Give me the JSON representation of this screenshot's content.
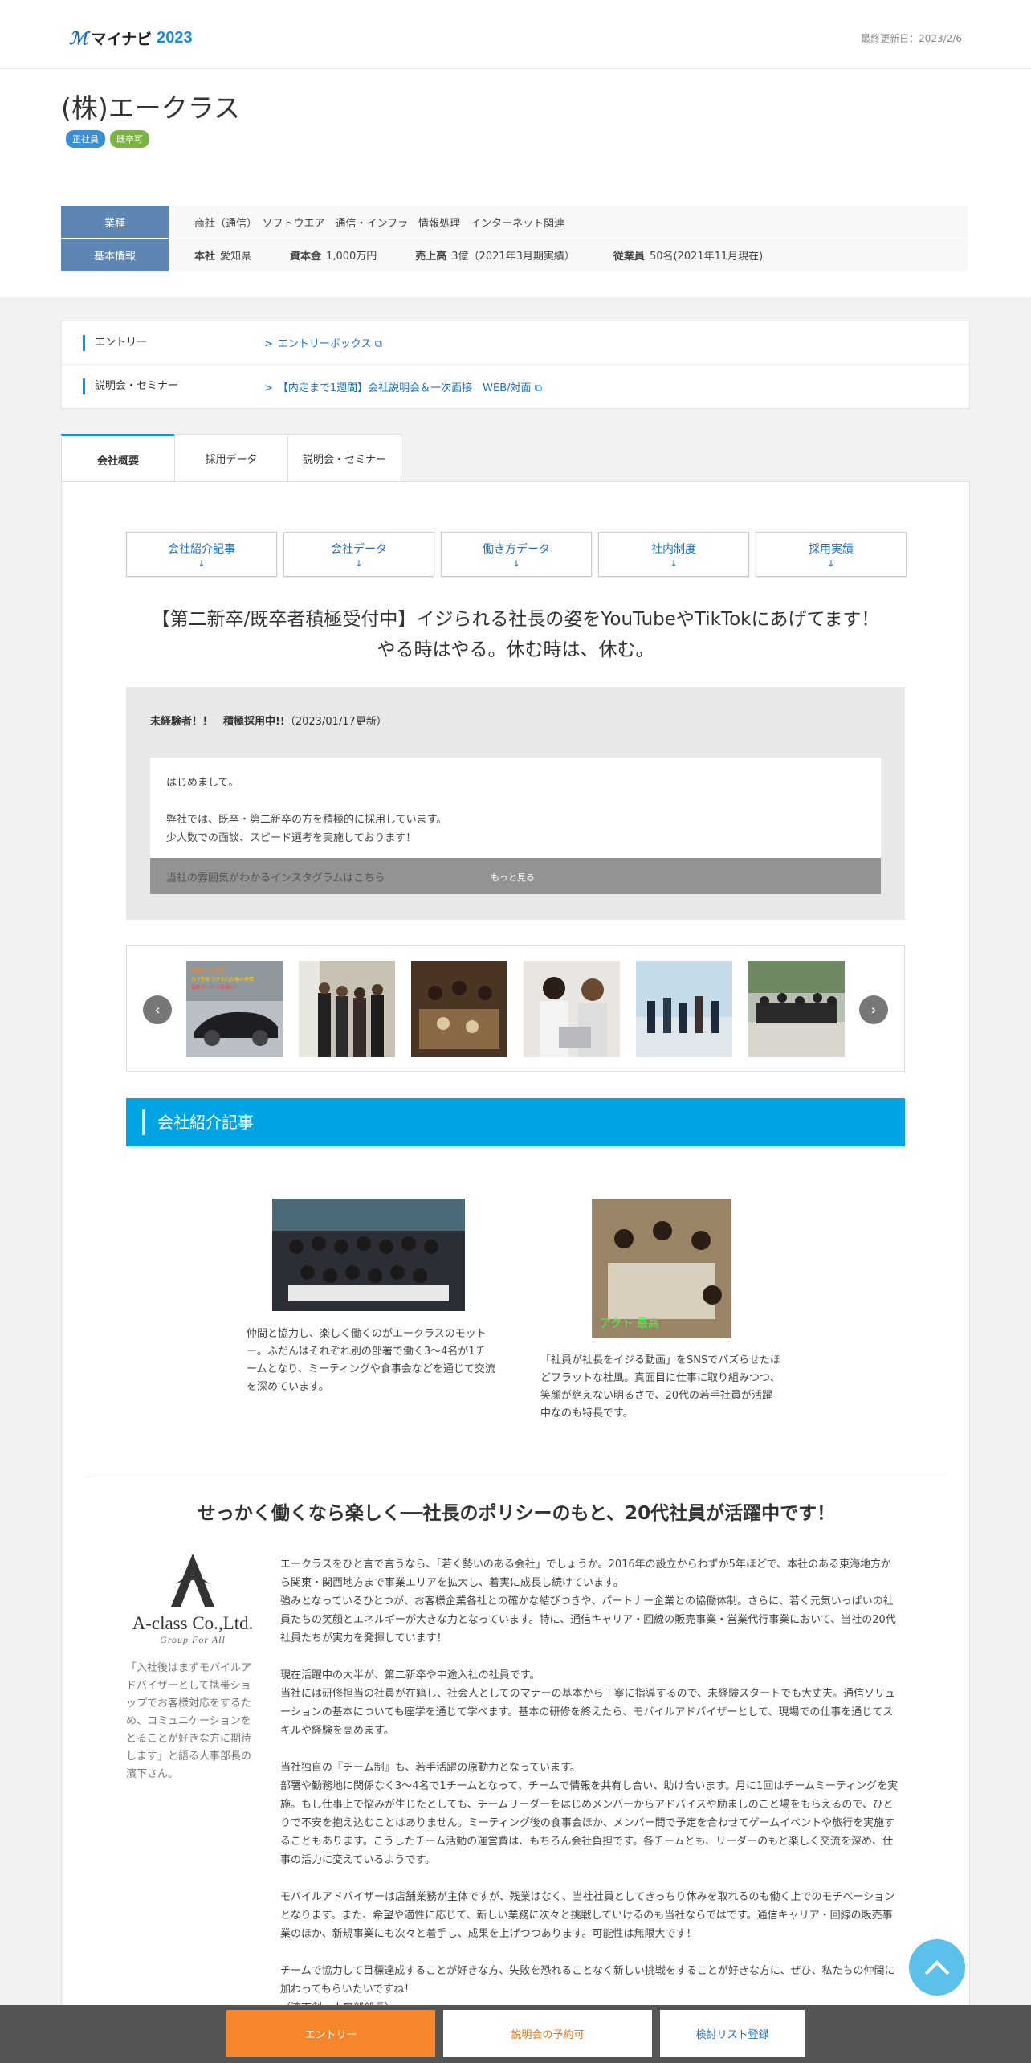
{
  "header": {
    "logo_text": "マイナビ",
    "logo_year": "2023",
    "last_updated": "最終更新日：2023/2/6"
  },
  "company": {
    "name": "(株)エークラス",
    "tags": [
      "正社員",
      "既卒可"
    ]
  },
  "info": {
    "industry_label": "業種",
    "industries": "商社（通信）　ソフトウエア　通信・インフラ　情報処理　インターネット関連",
    "basic_label": "基本情報",
    "hq_label": "本社",
    "hq": "愛知県",
    "capital_label": "資本金",
    "capital": "1,000万円",
    "sales_label": "売上高",
    "sales": "3億（2021年3月期実績）",
    "employees_label": "従業員",
    "employees": "50名(2021年11月現在)"
  },
  "links": {
    "entry_label": "エントリー",
    "entry_value": "エントリーボックス",
    "seminar_label": "説明会・セミナー",
    "seminar_value": "【内定まで1週間】会社説明会＆一次面接　WEB/対面"
  },
  "tabs": [
    "会社概要",
    "採用データ",
    "説明会・セミナー"
  ],
  "anchors": [
    "会社紹介記事",
    "会社データ",
    "働き方データ",
    "社内制度",
    "採用実績"
  ],
  "anchor_arrow": "↓",
  "headline": {
    "line1": "【第二新卒/既卒者積極受付中】イジられる社長の姿をYouTubeやTikTokにあげてます！",
    "line2": "やる時はやる。休む時は、休む。"
  },
  "news": {
    "title_bold": "未経験者！！　積極採用中!!",
    "date": "（2023/01/17更新）",
    "p1": "はじめまして。",
    "p2": "弊社では、既卒・第二新卒の方を積極的に採用しています。",
    "p3": "少人数での面談、スピード選考を実施しております！",
    "bar_label": "当社の雰囲気がわかるインスタグラムはこちら",
    "more": "もっと見る"
  },
  "gallery": {
    "prev": "‹",
    "next": "›",
    "thumb1_caption": "社長の 社長が…\nガイ形をつけられた後の表情\n最新ツールで楽撮中！"
  },
  "intro": {
    "section_title": "会社紹介記事",
    "text1": "仲間と協力し、楽しく働くのがエークラスのモットー。ふだんはそれぞれ別の部署で働く3～4名が1チームとなり、ミーティングや食事会などを通じて交流を深めています。",
    "text2": "「社員が社長をイジる動画」をSNSでバズらせたほどフラットな社風。真面目に仕事に取り組みつつ、笑顔が絶えない明るさで、20代の若手社員が活躍中なのも特長です。",
    "img2_label": "アクト 最高"
  },
  "article": {
    "headline": "せっかく働くなら楽しく──社長のポリシーのもと、20代社員が活躍中です！",
    "logo_name": "A-class Co.,Ltd.",
    "logo_sub": "Group For All",
    "quote": "「入社後はまずモバイルアドバイザーとして携帯ショップでお客様対応をするため、コミュニケーションをとることが好きな方に期待します」と語る人事部長の濱下さん。",
    "p1": "エークラスをひと言で言うなら、「若く勢いのある会社」でしょうか。2016年の設立からわずか5年ほどで、本社のある東海地方から関東・関西地方まで事業エリアを拡大し、着実に成長し続けています。\n強みとなっているひとつが、お客様企業各社との確かな結びつきや、パートナー企業との協働体制。さらに、若く元気いっぱいの社員たちの笑顔とエネルギーが大きな力となっています。特に、通信キャリア・回線の販売事業・営業代行事業において、当社の20代社員たちが実力を発揮しています！",
    "p2": "現在活躍中の大半が、第二新卒や中途入社の社員です。\n当社には研修担当の社員が在籍し、社会人としてのマナーの基本から丁寧に指導するので、未経験スタートでも大丈夫。通信ソリューションの基本についても座学を通じて学べます。基本の研修を終えたら、モバイルアドバイザーとして、現場での仕事を通じてスキルや経験を高めます。",
    "p3": "当社独自の『チーム制』も、若手活躍の原動力となっています。\n部署や勤務地に関係なく3～4名で1チームとなって、チームで情報を共有し合い、助け合います。月に1回はチームミーティングを実施。もし仕事上で悩みが生じたとしても、チームリーダーをはじめメンバーからアドバイスや励ましのこと場をもらえるので、ひとりで不安を抱え込むことはありません。ミーティング後の食事会ほか、メンバー間で予定を合わせてゲームイベントや旅行を実施することもあります。こうしたチーム活動の運営費は、もちろん会社負担です。各チームとも、リーダーのもと楽しく交流を深め、仕事の活力に変えているようです。",
    "p4": "モバイルアドバイザーは店舗業務が主体ですが、残業はなく、当社社員としてきっちり休みを取れるのも働く上でのモチベーションとなります。また、希望や適性に応じて、新しい業務に次々と挑戦していけるのも当社ならではです。通信キャリア・回線の販売事業のほか、新規事業にも次々と着手し、成果を上げつつあります。可能性は無限大です！",
    "p5": "チームで協力して目標達成することが好きな方、失敗を恐れることなく新しい挑戦をすることが好きな方に、ぜひ、私たちの仲間に加わってもらいたいですね！\n（濱下創・人事部部長）"
  },
  "bottom": {
    "entry": "エントリー",
    "seminar": "説明会の予約可",
    "list": "検討リスト登録",
    "to_top": "︿"
  },
  "colors": {
    "brand_blue": "#1a8fd6",
    "entry_orange": "#f5862b",
    "banner_cyan": "#00a4e4"
  }
}
